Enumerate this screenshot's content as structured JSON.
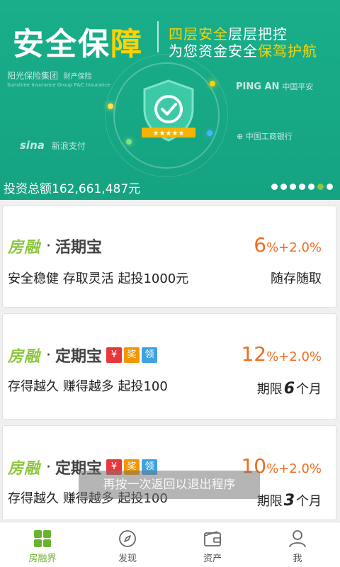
{
  "banner": {
    "title_main": "安全保",
    "title_accent": "障",
    "slogan_line1_a": "四层安全",
    "slogan_line1_b": "层层把控",
    "slogan_line2_a": "为您资金安全",
    "slogan_line2_b": "保驾护航",
    "partners": {
      "sunshine": "阳光保险集团",
      "sunshine_sub": "财产保险",
      "sunshine_en": "Sunshine Insurance Group   P&C Insurance",
      "pingan_en": "PING AN",
      "pingan_cn": "中国平安",
      "icbc": "中国工商银行",
      "sina_logo": "sina",
      "sina_pay": "新浪支付"
    },
    "invest_total": "投资总额162,661,487元",
    "carousel_total": 7,
    "carousel_active_index": 5,
    "colors": {
      "bg": "#1aae8a",
      "accent": "#ffd200",
      "active_dot": "#8cc63f"
    }
  },
  "products": [
    {
      "brand": "房融",
      "separator": "·",
      "name": "活期宝",
      "rate_big": "6",
      "rate_rest": "%+2.0%",
      "desc": "安全稳健 存取灵活 起投1000元",
      "term": "随存随取"
    },
    {
      "brand": "房融",
      "separator": "·",
      "name": "定期宝",
      "tags": [
        "¥",
        "奖",
        "领"
      ],
      "rate_big": "12",
      "rate_rest": "%+2.0%",
      "desc": "存得越久 赚得越多 起投100",
      "term_prefix": "期限",
      "term_num": "6",
      "term_suffix": "个月"
    },
    {
      "brand": "房融",
      "separator": "·",
      "name": "定期宝",
      "tags": [
        "¥",
        "奖",
        "领"
      ],
      "rate_big": "10",
      "rate_rest": "%+2.0%",
      "desc": "存得越久 赚得越多 起投100",
      "term_prefix": "期限",
      "term_num": "3",
      "term_suffix": "个月"
    }
  ],
  "toast": "再按一次返回以退出程序",
  "bottom_nav": [
    {
      "label": "房融界",
      "icon": "grid-icon",
      "active": true
    },
    {
      "label": "发现",
      "icon": "compass-icon",
      "active": false
    },
    {
      "label": "资产",
      "icon": "wallet-icon",
      "active": false
    },
    {
      "label": "我",
      "icon": "user-icon",
      "active": false
    }
  ]
}
